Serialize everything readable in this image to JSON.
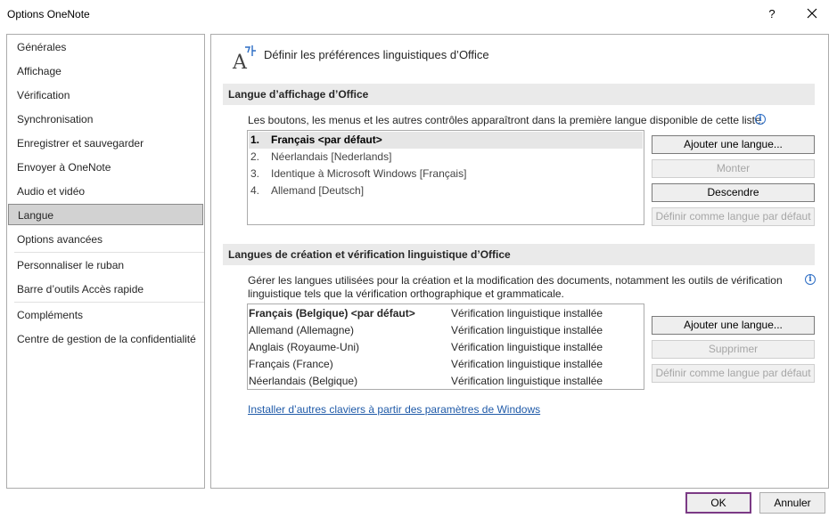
{
  "window": {
    "title": "Options OneNote",
    "help_label": "?"
  },
  "sidebar": {
    "items": [
      {
        "label": "Générales"
      },
      {
        "label": "Affichage"
      },
      {
        "label": "Vérification"
      },
      {
        "label": "Synchronisation"
      },
      {
        "label": "Enregistrer et sauvegarder"
      },
      {
        "label": "Envoyer à OneNote"
      },
      {
        "label": "Audio et vidéo"
      },
      {
        "label": "Langue",
        "selected": true
      },
      {
        "label": "Options avancées"
      },
      {
        "label": "Personnaliser le ruban"
      },
      {
        "label": "Barre d’outils Accès rapide"
      },
      {
        "label": "Compléments"
      },
      {
        "label": "Centre de gestion de la confidentialité"
      }
    ]
  },
  "main": {
    "header_title": "Définir les préférences linguistiques d’Office",
    "header_icon": "language-icon",
    "display_section": {
      "title": "Langue d’affichage d’Office",
      "description": "Les boutons, les menus et les autres contrôles apparaîtront dans la première langue disponible de cette liste.",
      "languages": [
        {
          "num": "1.",
          "name": "Français <par défaut>",
          "selected": true
        },
        {
          "num": "2.",
          "name": "Néerlandais [Nederlands]"
        },
        {
          "num": "3.",
          "name": "Identique à Microsoft Windows [Français]"
        },
        {
          "num": "4.",
          "name": "Allemand [Deutsch]"
        }
      ],
      "buttons": {
        "add": "Ajouter une langue...",
        "move_up": "Monter",
        "move_down": "Descendre",
        "set_default": "Définir comme langue par défaut"
      }
    },
    "editing_section": {
      "title": "Langues de création et vérification linguistique d’Office",
      "description_line1": "Gérer les langues utilisées pour la création et la modification des documents, notamment les outils de vérification",
      "description_line2": "linguistique tels que la vérification orthographique et grammaticale.",
      "languages": [
        {
          "name": "Français (Belgique) <par défaut>",
          "status": "Vérification linguistique installée",
          "default": true
        },
        {
          "name": "Allemand (Allemagne)",
          "status": "Vérification linguistique installée"
        },
        {
          "name": "Anglais (Royaume-Uni)",
          "status": "Vérification linguistique installée"
        },
        {
          "name": "Français (France)",
          "status": "Vérification linguistique installée"
        },
        {
          "name": "Néerlandais (Belgique)",
          "status": "Vérification linguistique installée"
        }
      ],
      "buttons": {
        "add": "Ajouter une langue...",
        "remove": "Supprimer",
        "set_default": "Définir comme langue par défaut"
      },
      "keyboards_link": "Installer d’autres claviers à partir des paramètres de Windows"
    }
  },
  "footer": {
    "ok": "OK",
    "cancel": "Annuler"
  },
  "colors": {
    "accent": "#7b3a85",
    "link": "#1f5aa8",
    "info": "#2b6cc4"
  }
}
